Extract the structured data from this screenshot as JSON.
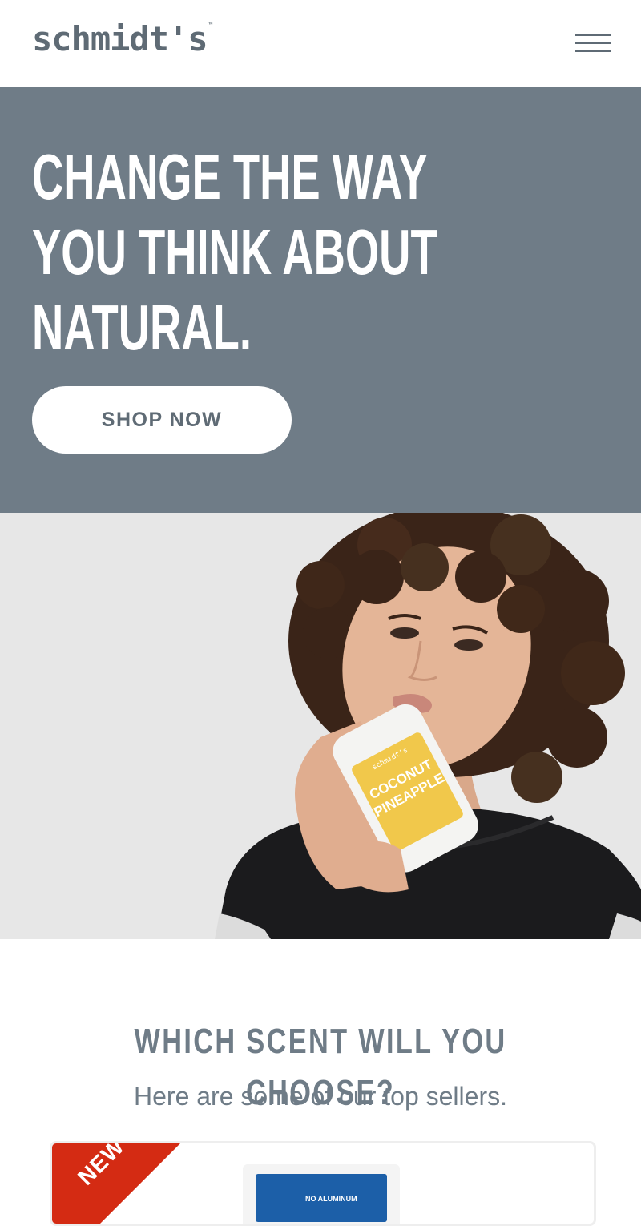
{
  "header": {
    "logo_text": "schmidt's",
    "logo_tm": "™",
    "menu_icon": "hamburger-menu-icon"
  },
  "hero": {
    "title_line1": "CHANGE THE WAY",
    "title_line2": "YOU THINK ABOUT",
    "title_line3": "NATURAL.",
    "cta_label": "SHOP NOW",
    "background_color": "#6f7c87"
  },
  "photo": {
    "product_label_line1": "COCONUT",
    "product_label_line2": "PINEAPPLE",
    "product_brand": "schmidt's"
  },
  "scents": {
    "title": "WHICH SCENT WILL YOU CHOOSE?",
    "subtitle": "Here are some of our top sellers.",
    "badge": "NEW",
    "product_label": "NO ALUMINUM",
    "badge_color": "#d42b13",
    "label_color": "#1c5fa8"
  }
}
